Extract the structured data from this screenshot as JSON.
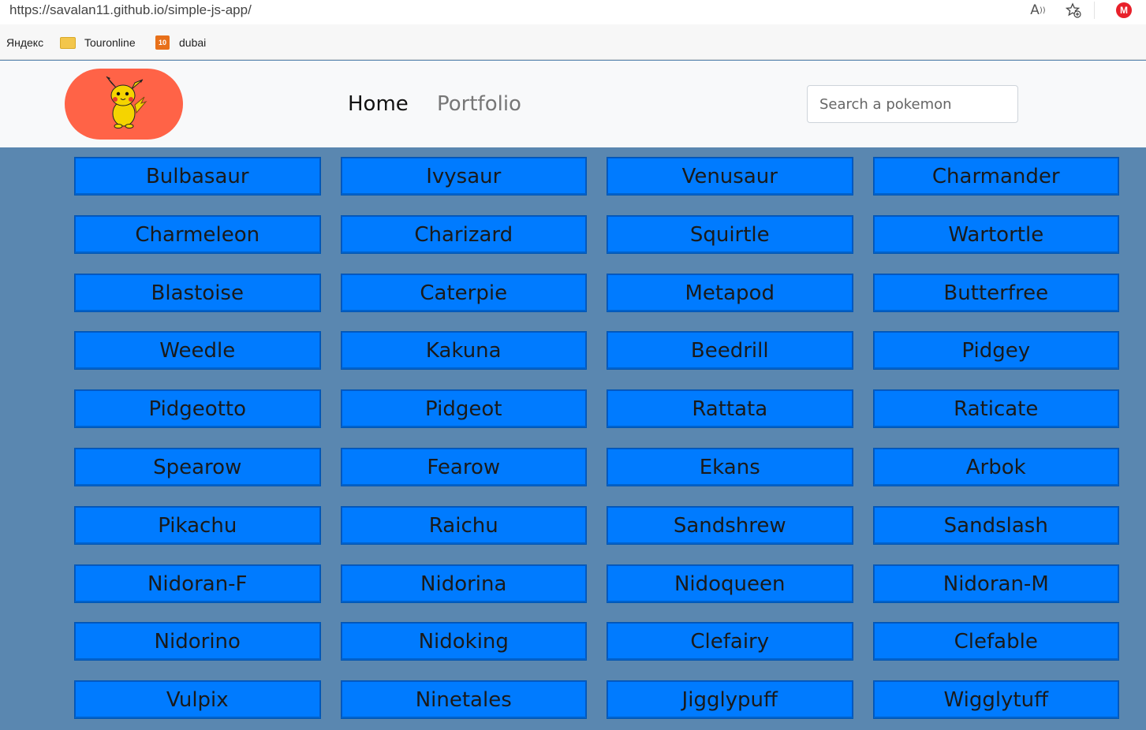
{
  "browser": {
    "url": "https://savalan11.github.io/simple-js-app/",
    "bookmarks": [
      {
        "label": "Яндекс",
        "icon": "none"
      },
      {
        "label": "Touronline",
        "icon": "folder-icon"
      },
      {
        "label": "dubai",
        "icon": "ten-badge-icon",
        "badge": "10"
      }
    ],
    "profile_initial": "M",
    "colors": {
      "profile": "#e8202a",
      "folder": "#f3c64b"
    }
  },
  "navbar": {
    "logo_icon": "pikachu-icon",
    "links": [
      "Home",
      "Portfolio"
    ],
    "search_placeholder": "Search a pokemon",
    "colors": {
      "logo_bg": "#ff6347",
      "navbar_bg": "#f8f9fa"
    }
  },
  "pokemon": [
    [
      "Bulbasaur",
      "Ivysaur",
      "Venusaur",
      "Charmander"
    ],
    [
      "Charmeleon",
      "Charizard",
      "Squirtle",
      "Wartortle"
    ],
    [
      "Blastoise",
      "Caterpie",
      "Metapod",
      "Butterfree"
    ],
    [
      "Weedle",
      "Kakuna",
      "Beedrill",
      "Pidgey"
    ],
    [
      "Pidgeotto",
      "Pidgeot",
      "Rattata",
      "Raticate"
    ],
    [
      "Spearow",
      "Fearow",
      "Ekans",
      "Arbok"
    ],
    [
      "Pikachu",
      "Raichu",
      "Sandshrew",
      "Sandslash"
    ],
    [
      "Nidoran-F",
      "Nidorina",
      "Nidoqueen",
      "Nidoran-M"
    ],
    [
      "Nidorino",
      "Nidoking",
      "Clefairy",
      "Clefable"
    ],
    [
      "Vulpix",
      "Ninetales",
      "Jigglypuff",
      "Wigglytuff"
    ]
  ],
  "colors": {
    "page_bg": "#5a87b0",
    "button_bg": "#007bff"
  }
}
